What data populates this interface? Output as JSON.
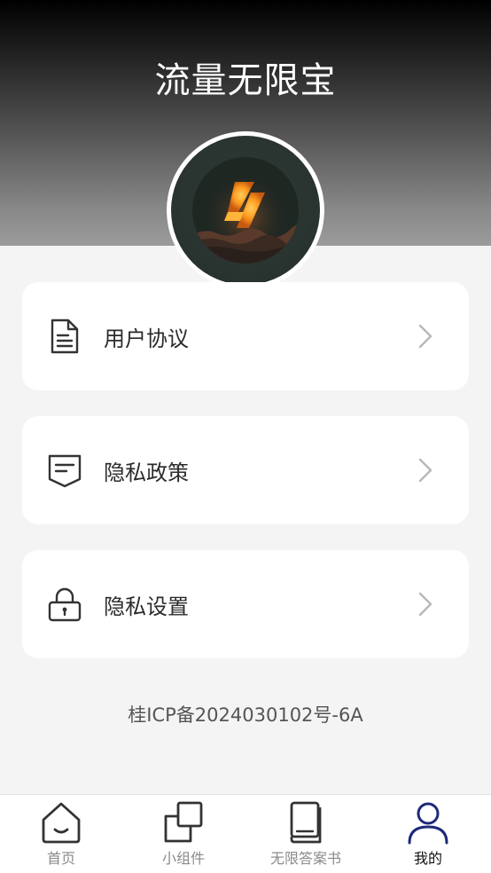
{
  "header": {
    "title": "流量无限宝"
  },
  "menu": [
    {
      "label": "用户协议",
      "icon": "document-icon"
    },
    {
      "label": "隐私政策",
      "icon": "message-shield-icon"
    },
    {
      "label": "隐私设置",
      "icon": "lock-icon"
    }
  ],
  "footer": {
    "icp": "桂ICP备2024030102号-6A"
  },
  "tabbar": {
    "items": [
      {
        "label": "首页",
        "icon": "home-icon",
        "active": false
      },
      {
        "label": "小组件",
        "icon": "widget-icon",
        "active": false
      },
      {
        "label": "无限答案书",
        "icon": "book-icon",
        "active": false
      },
      {
        "label": "我的",
        "icon": "user-icon",
        "active": true
      }
    ]
  },
  "colors": {
    "active_tab_icon": "#1f2a7a",
    "inactive_tab": "#8a8a8a",
    "card_bg": "#ffffff",
    "page_bg": "#f4f4f4"
  }
}
